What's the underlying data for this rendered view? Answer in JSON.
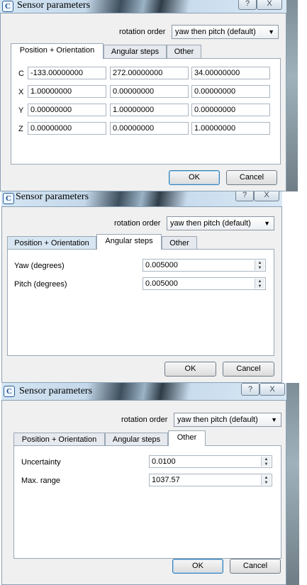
{
  "dialogs": [
    {
      "title": "Sensor parameters",
      "help_button": "?",
      "close_button": "X",
      "rotation_order": {
        "label": "rotation order",
        "value": "yaw then pitch (default)"
      },
      "tabs": [
        "Position + Orientation",
        "Angular steps",
        "Other"
      ],
      "active_tab": "Position + Orientation",
      "rows": [
        {
          "label": "C",
          "values": [
            "-133.00000000",
            "272.00000000",
            "34.00000000"
          ]
        },
        {
          "label": "X",
          "values": [
            "1.00000000",
            "0.00000000",
            "0.00000000"
          ]
        },
        {
          "label": "Y",
          "values": [
            "0.00000000",
            "1.00000000",
            "0.00000000"
          ]
        },
        {
          "label": "Z",
          "values": [
            "0.00000000",
            "0.00000000",
            "1.00000000"
          ]
        }
      ],
      "ok": "OK",
      "cancel": "Cancel"
    },
    {
      "title": "Sensor parameters",
      "help_button": "?",
      "close_button": "X",
      "rotation_order": {
        "label": "rotation order",
        "value": "yaw then pitch (default)"
      },
      "tabs": [
        "Position + Orientation",
        "Angular steps",
        "Other"
      ],
      "active_tab": "Angular steps",
      "fields": [
        {
          "label": "Yaw (degrees)",
          "value": "0.005000"
        },
        {
          "label": "Pitch (degrees)",
          "value": "0.005000"
        }
      ],
      "ok": "OK",
      "cancel": "Cancel"
    },
    {
      "title": "Sensor parameters",
      "help_button": "?",
      "close_button": "X",
      "rotation_order": {
        "label": "rotation order",
        "value": "yaw then pitch (default)"
      },
      "tabs": [
        "Position + Orientation",
        "Angular steps",
        "Other"
      ],
      "active_tab": "Other",
      "fields": [
        {
          "label": "Uncertainty",
          "value": "0.0100"
        },
        {
          "label": "Max. range",
          "value": "1037.57"
        }
      ],
      "ok": "OK",
      "cancel": "Cancel"
    }
  ]
}
